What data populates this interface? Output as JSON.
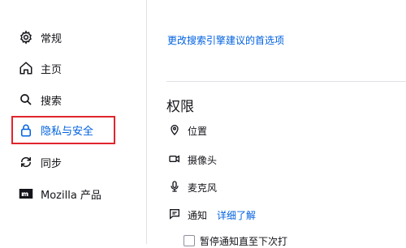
{
  "sidebar": {
    "items": [
      {
        "label": "常规",
        "icon": "gear-icon"
      },
      {
        "label": "主页",
        "icon": "home-icon"
      },
      {
        "label": "搜索",
        "icon": "search-icon"
      },
      {
        "label": "隐私与安全",
        "icon": "lock-icon",
        "active": true
      },
      {
        "label": "同步",
        "icon": "sync-icon"
      },
      {
        "label": "Mozilla 产品",
        "icon": "mozilla-logo-icon"
      }
    ]
  },
  "search_engine_link": "更改搜索引擎建议的首选项",
  "permissions": {
    "title": "权限",
    "items": [
      {
        "label": "位置",
        "icon": "location-icon"
      },
      {
        "label": "摄像头",
        "icon": "camera-icon"
      },
      {
        "label": "麦克风",
        "icon": "microphone-icon"
      },
      {
        "label": "通知",
        "icon": "notification-icon",
        "link": "详细了解"
      }
    ],
    "pause_checkbox": "暂停通知直至下次打"
  },
  "colors": {
    "accent": "#0061e0",
    "highlight": "#e0252c"
  }
}
